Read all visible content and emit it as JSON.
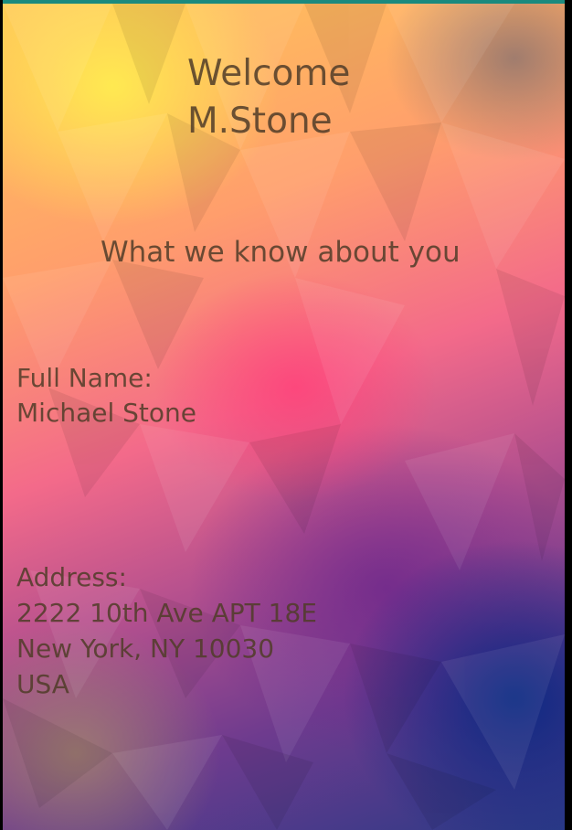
{
  "header": {
    "welcome_line1": "Welcome",
    "welcome_line2": "M.Stone"
  },
  "subtitle": "What we know about you",
  "full_name": {
    "label": "Full Name:",
    "value": "Michael Stone"
  },
  "address": {
    "label": "Address:",
    "line1": "2222 10th Ave APT 18E",
    "line2": "New York, NY 10030",
    "line3": "USA"
  },
  "colors": {
    "status_strip": "#1a8a7e",
    "text": "#5d4a36"
  }
}
